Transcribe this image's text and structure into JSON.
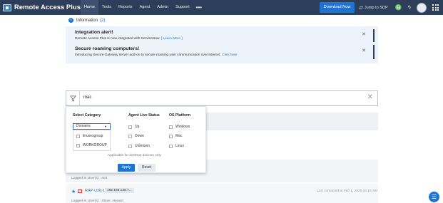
{
  "header": {
    "brand": "Remote Access Plus",
    "nav": [
      "Home",
      "Tools",
      "Reports",
      "Agent",
      "Admin",
      "Support"
    ],
    "more_icon": "more-icon",
    "download_label": "Download Now",
    "jump_label": "Jump to SDP"
  },
  "info": {
    "label": "Information",
    "count": "(2)",
    "alerts": [
      {
        "title": "Integration alert!",
        "text": "Remote Access Plus is now integrated with ServiceNow.",
        "link": "[ Learn More ]"
      },
      {
        "title": "Secure roaming computers!",
        "text": "Introducing Secure Gateway server add-on to secure roaming user communication over internet.",
        "link": "Click here"
      }
    ]
  },
  "search": {
    "value": "mac"
  },
  "filter": {
    "category_header": "Select Category",
    "status_header": "Agent Live Status",
    "os_header": "OS Platform",
    "selected_category": "Domains",
    "category_options": [
      "linuxesgroup",
      "WORKGROUP"
    ],
    "status_options": [
      "Up",
      "Down",
      "Unknown"
    ],
    "os_options": [
      "Windows",
      "Mac",
      "Linux"
    ],
    "note": "Applicable for desktop devices only",
    "apply_label": "Apply",
    "reset_label": "Reset"
  },
  "rows": {
    "logged_in_1": "Logged-in User(s) : test",
    "device_name": "RAP-U20-1",
    "device_ip": "192.168.138.7...",
    "last_contact": "Last contacted at Feb 1, 2025 04:15 AM",
    "logged_in_2": "Logged-in User(s) : Steve_stewart"
  },
  "colors": {
    "topbar": "#2c3e59",
    "accent": "#1e73d8",
    "alert_bg": "#edf3fa"
  }
}
